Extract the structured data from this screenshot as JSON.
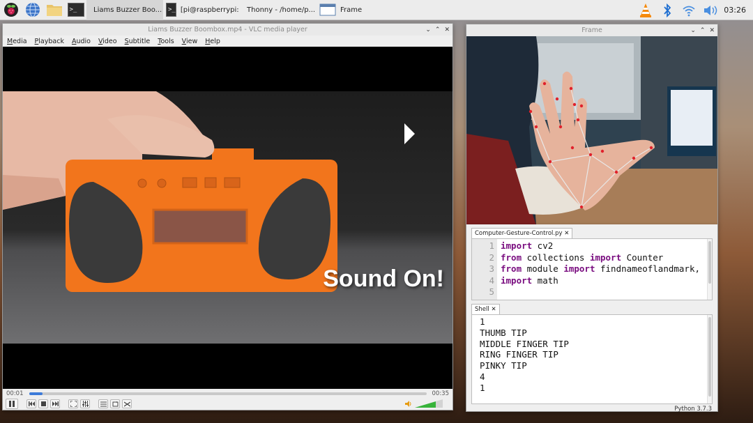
{
  "taskbar": {
    "launchers": [
      {
        "icon": "raspberry-pi-menu-icon"
      },
      {
        "icon": "web-browser-icon"
      },
      {
        "icon": "file-manager-icon"
      },
      {
        "icon": "terminal-icon",
        "glyph": ">_"
      }
    ],
    "tasks": [
      {
        "label": "Liams Buzzer Boo...",
        "icon": "vlc-cone-icon",
        "active": true
      },
      {
        "label": "[pi@raspberrypi: ~]",
        "icon": "terminal-icon",
        "glyph": ">_"
      },
      {
        "label": "Thonny  -  /home/p...",
        "icon": "thonny-icon"
      },
      {
        "label": "Frame",
        "icon": "window-icon"
      }
    ],
    "tray": [
      {
        "icon": "vlc-tray-icon"
      },
      {
        "icon": "bluetooth-icon"
      },
      {
        "icon": "wifi-icon"
      },
      {
        "icon": "volume-icon"
      }
    ],
    "clock": "03:26"
  },
  "vlc": {
    "title": "Liams Buzzer Boombox.mp4 - VLC media player",
    "menu": [
      "Media",
      "Playback",
      "Audio",
      "Video",
      "Subtitle",
      "Tools",
      "View",
      "Help"
    ],
    "overlay_text": "Sound On!",
    "time_elapsed": "00:01",
    "time_total": "00:35",
    "progress": 0.035,
    "volume": 0.75,
    "accent_color": "#3d7bd9"
  },
  "frame": {
    "title": "Frame"
  },
  "thonny": {
    "file_tab": "Computer-Gesture-Control.py",
    "code": [
      {
        "n": "1",
        "parts": [
          {
            "t": "import",
            "kw": true
          },
          {
            "t": " cv2",
            "kw": false
          }
        ]
      },
      {
        "n": "2",
        "parts": [
          {
            "t": "from",
            "kw": true
          },
          {
            "t": " collections ",
            "kw": false
          },
          {
            "t": "import",
            "kw": true
          },
          {
            "t": " Counter",
            "kw": false
          }
        ]
      },
      {
        "n": "3",
        "parts": [
          {
            "t": "from",
            "kw": true
          },
          {
            "t": " module ",
            "kw": false
          },
          {
            "t": "import",
            "kw": true
          },
          {
            "t": " findnameoflandmark,",
            "kw": false
          }
        ]
      },
      {
        "n": "4",
        "parts": [
          {
            "t": "import",
            "kw": true
          },
          {
            "t": " math",
            "kw": false
          }
        ]
      },
      {
        "n": "5",
        "parts": []
      }
    ],
    "shell_tab": "Shell",
    "shell_lines": [
      "1",
      "THUMB TIP",
      "MIDDLE FINGER TIP",
      "RING FINGER TIP",
      "PINKY TIP",
      "4",
      "1"
    ],
    "status": "Python 3.7.3"
  }
}
